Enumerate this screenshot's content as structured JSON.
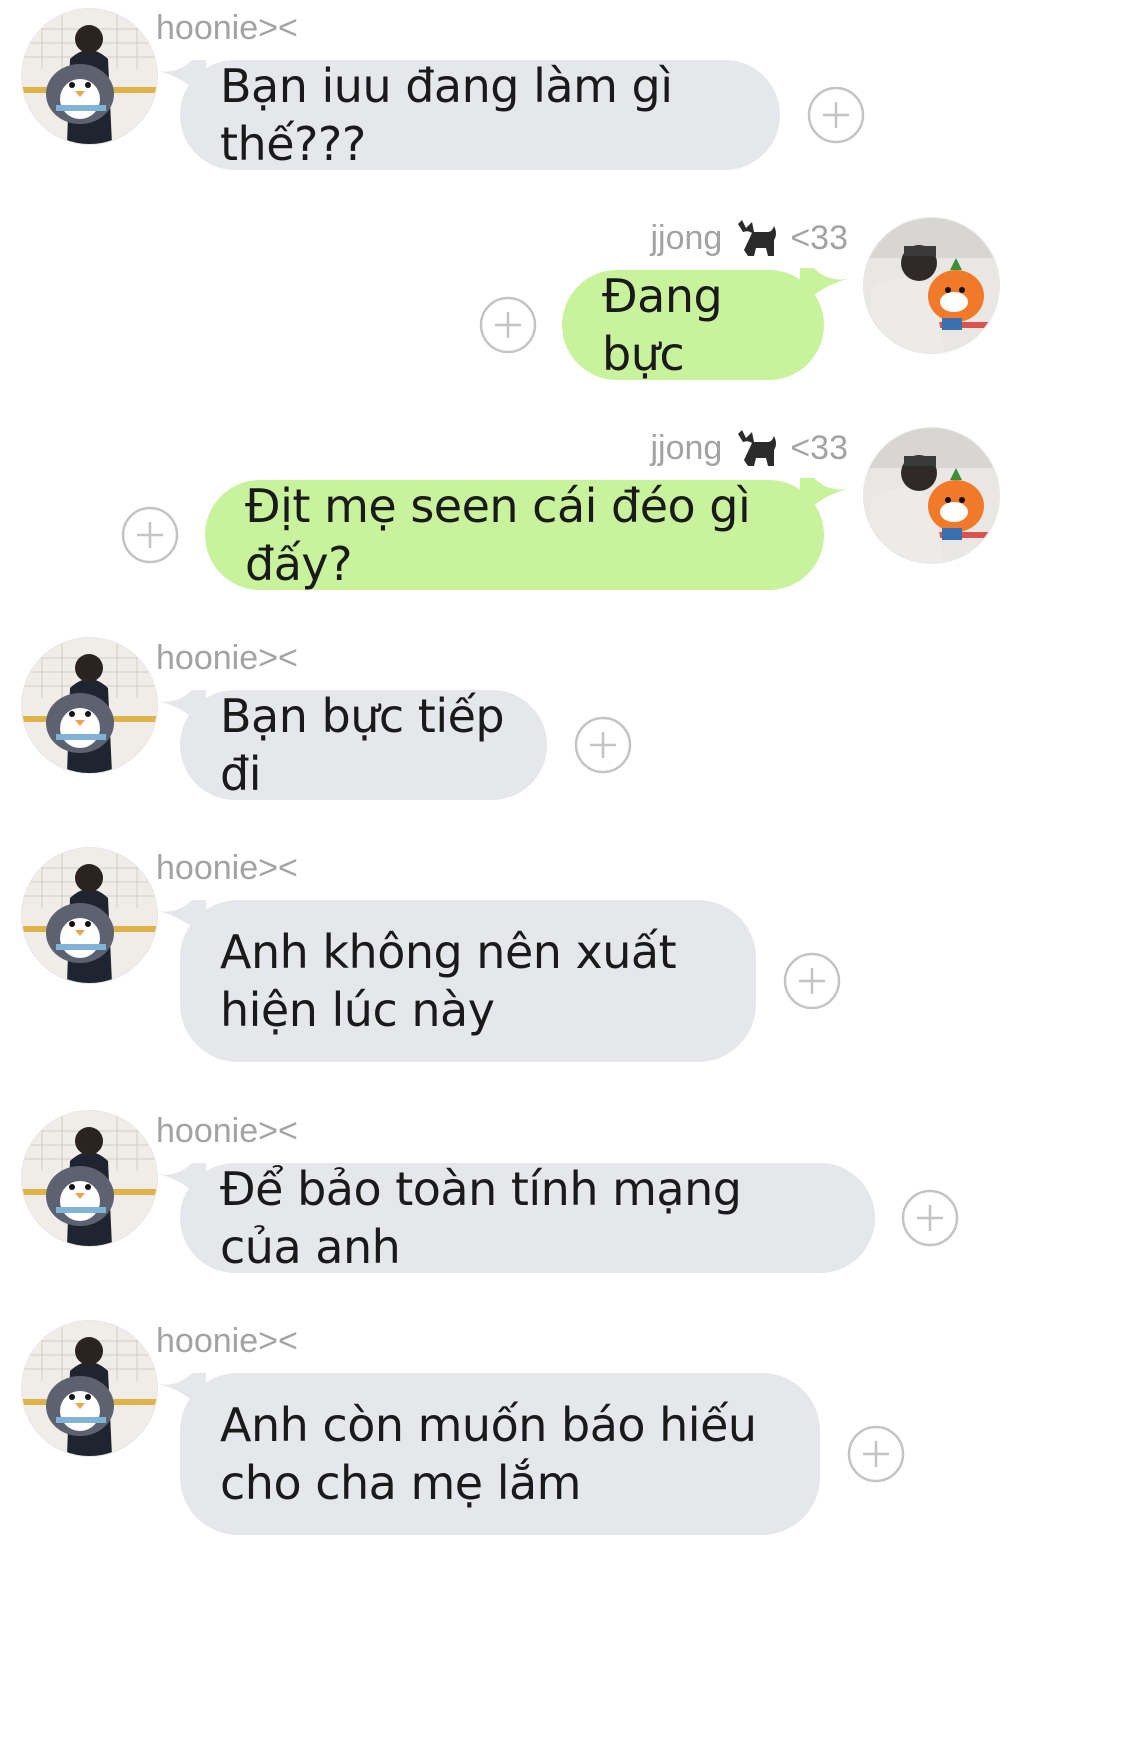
{
  "chat": {
    "messages": [
      {
        "sender": "hoonie><",
        "side": "in",
        "text": "Bạn iuu đang làm gì thế???"
      },
      {
        "sender": "jjong",
        "sender_suffix": "<33",
        "sender_icon": "black-cat-emoji",
        "side": "out",
        "text": "Đang bực"
      },
      {
        "sender": "jjong",
        "sender_suffix": "<33",
        "sender_icon": "black-cat-emoji",
        "side": "out",
        "text": "Địt mẹ seen cái đéo gì đấy?"
      },
      {
        "sender": "hoonie><",
        "side": "in",
        "text": "Bạn bực tiếp đi"
      },
      {
        "sender": "hoonie><",
        "side": "in",
        "text": "Anh không nên xuất hiện lúc này"
      },
      {
        "sender": "hoonie><",
        "side": "in",
        "text": "Để bảo toàn tính mạng của anh"
      },
      {
        "sender": "hoonie><",
        "side": "in",
        "text": "Anh còn muốn báo hiếu cho cha mẹ lắm"
      }
    ]
  },
  "colors": {
    "incoming_bubble": "#e5e7ea",
    "outgoing_bubble": "#c9f29c",
    "sender_name": "#a3a3a3",
    "plus_icon": "#c4c4c4"
  },
  "icons": {
    "add_reaction": "plus-circle-icon",
    "avatar_incoming": "avatar-penguin-plush",
    "avatar_outgoing": "avatar-orange-plush"
  }
}
